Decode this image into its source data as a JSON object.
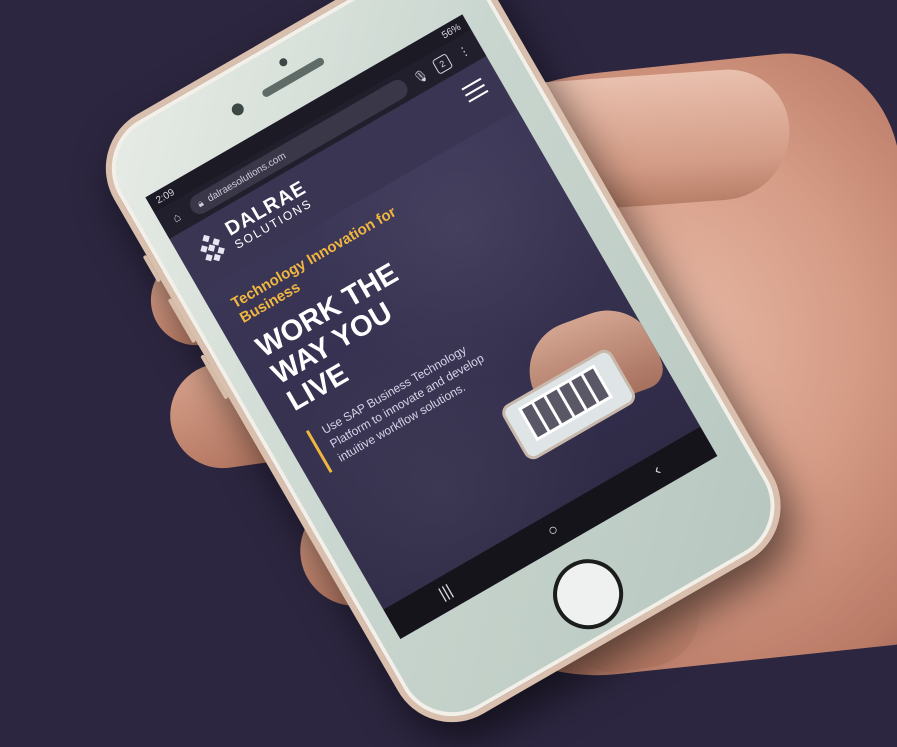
{
  "status_bar": {
    "time": "2:09",
    "battery": "56%"
  },
  "browser": {
    "url": "dalraesolutions.com",
    "home_icon": "home-icon",
    "mic_icon": "mic-icon",
    "tabs_count": "2"
  },
  "site": {
    "logo_main": "DALRAE",
    "logo_sub": "SOLUTIONS",
    "tagline": "Technology Innovation for Business",
    "headline": "WORK THE WAY YOU LIVE",
    "copy": "Use SAP Business Technology Platform to innovate and develop intuitive workflow solutions.",
    "accent_color": "#f0b640"
  },
  "android_nav": {
    "recent": "|||",
    "home": "○",
    "back": "‹"
  }
}
